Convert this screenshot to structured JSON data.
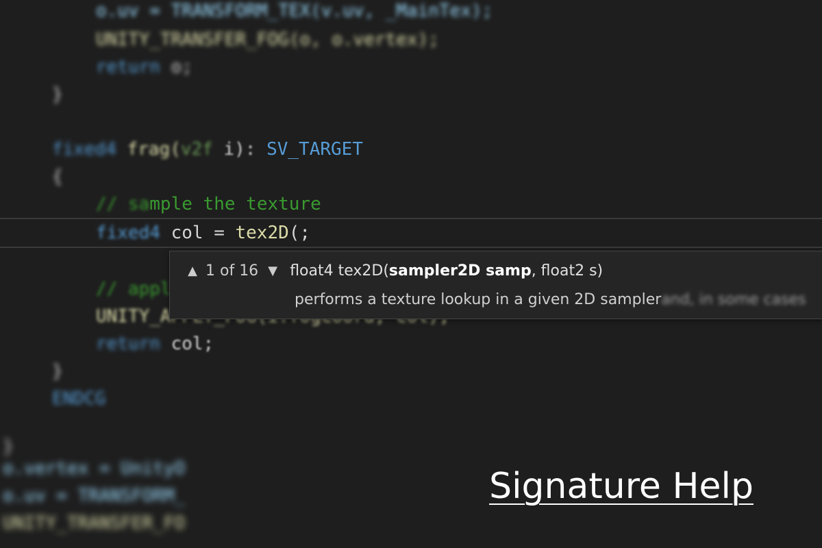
{
  "editor": {
    "lines": {
      "l1": "o.uv = TRANSFORM_TEX(v.uv, _MainTex);",
      "l2": "UNITY_TRANSFER_FOG(o, o.vertex);",
      "l3_kw": "return",
      "l3_rest": " o;",
      "l4": "}",
      "l5_kw": "fixed4",
      "l5_fn": " frag(",
      "l5_type": "v2f",
      "l5_rest": " i): ",
      "l5_sem": "SV_TARGET",
      "l6": "{",
      "l7_blur": "// sa",
      "l7_clear": "mple the texture",
      "l8_type": "fixed4",
      "l8_rest": " col = ",
      "l8_fn": "tex2D",
      "l8_end": "(;",
      "l9": "// apply fog",
      "l10": "UNITY_APPLY_FOG(i.fogCoord, col);",
      "l11_kw": "return",
      "l11_rest": " col;",
      "l12": "}",
      "l13": "ENDCG",
      "l14": "}",
      "l15": "o.vertex = UnityO",
      "l16": "o.uv = TRANSFORM_",
      "l17": "UNITY_TRANSFER_FO"
    }
  },
  "signature_help": {
    "up_icon": "triangle-up-icon",
    "down_icon": "triangle-down-icon",
    "counter": "1 of 16",
    "return_type": "float4 tex2D(",
    "active_param": "sampler2D samp",
    "rest_params": ", float2 s)",
    "doc_clear": "performs a texture lookup in a given 2D sampler",
    "doc_faded": " and, in some cases"
  },
  "caption": "Signature Help"
}
